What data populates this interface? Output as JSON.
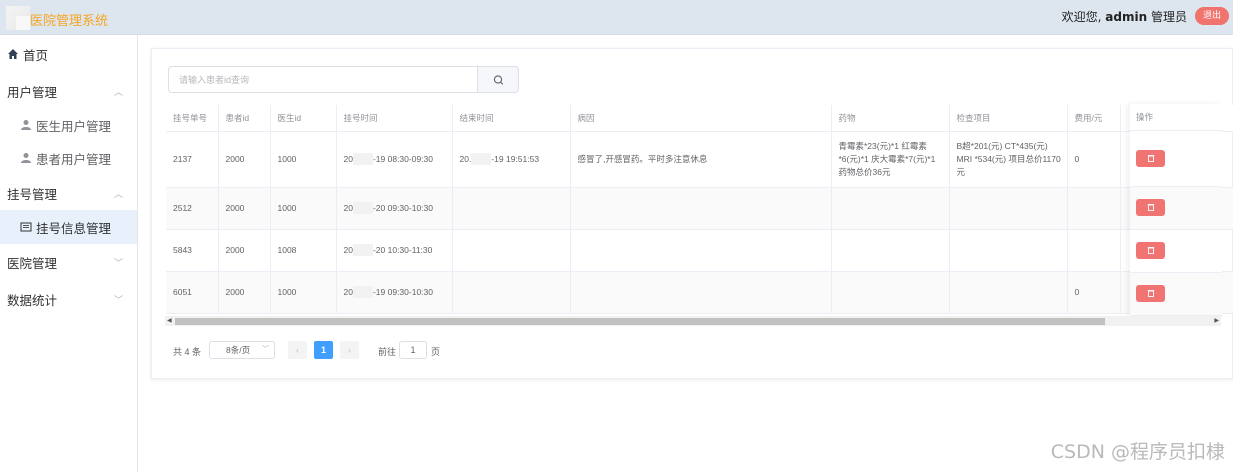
{
  "header": {
    "app_title": "医院管理系统",
    "welcome_prefix": "欢迎您, ",
    "username": "admin",
    "role": "管理员",
    "logout_label": "退出"
  },
  "sidebar": {
    "items": [
      {
        "label": "首页",
        "icon": "home-icon"
      },
      {
        "label": "用户管理",
        "expanded": true
      },
      {
        "label": "医生用户管理",
        "icon": "user-icon"
      },
      {
        "label": "患者用户管理",
        "icon": "user-icon"
      },
      {
        "label": "挂号管理",
        "expanded": true
      },
      {
        "label": "挂号信息管理",
        "icon": "document-icon",
        "active": true
      },
      {
        "label": "医院管理",
        "expanded": false
      },
      {
        "label": "数据统计",
        "expanded": false
      }
    ]
  },
  "search": {
    "placeholder": "请输入患者id查询",
    "icon": "search-icon"
  },
  "table": {
    "columns": [
      "挂号单号",
      "患者id",
      "医生id",
      "挂号时间",
      "结束时间",
      "病因",
      "药物",
      "检查项目",
      "费用/元",
      "操作"
    ],
    "rows": [
      {
        "reg_no": "2137",
        "patient_id": "2000",
        "doctor_id": "1000",
        "reg_time_prefix": "20",
        "reg_time_suffix": "-19 08:30-09:30",
        "end_time_prefix": "20.",
        "end_time_suffix": "-19 19:51:53",
        "cause": "感冒了,开感冒药。平时多注意休息",
        "medicine": "青霉素*23(元)*1 红霉素*6(元)*1 庆大霉素*7(元)*1 药物总价36元",
        "exam": "B超*201(元) CT*435(元) MRI *534(元) 项目总价1170元",
        "fee": "0"
      },
      {
        "reg_no": "2512",
        "patient_id": "2000",
        "doctor_id": "1000",
        "reg_time_prefix": "20",
        "reg_time_suffix": "-20 09:30-10:30",
        "end_time_prefix": "",
        "end_time_suffix": "",
        "cause": "",
        "medicine": "",
        "exam": "",
        "fee": ""
      },
      {
        "reg_no": "5843",
        "patient_id": "2000",
        "doctor_id": "1008",
        "reg_time_prefix": "20",
        "reg_time_suffix": "-20 10:30-11:30",
        "end_time_prefix": "",
        "end_time_suffix": "",
        "cause": "",
        "medicine": "",
        "exam": "",
        "fee": ""
      },
      {
        "reg_no": "6051",
        "patient_id": "2000",
        "doctor_id": "1000",
        "reg_time_prefix": "20",
        "reg_time_suffix": "-19 09:30-10:30",
        "end_time_prefix": "",
        "end_time_suffix": "",
        "cause": "",
        "medicine": "",
        "exam": "",
        "fee": "0"
      }
    ],
    "delete_icon": "trash-icon"
  },
  "pagination": {
    "total_label": "共 4 条",
    "page_size_label": "8条/页",
    "current_page": "1",
    "goto_label": "前往",
    "goto_value": "1",
    "page_unit": "页"
  },
  "watermark": "CSDN @程序员扣棣",
  "colors": {
    "header_bg": "#dde5ee",
    "title_color": "#f5a623",
    "danger": "#f07572",
    "primary": "#409eff"
  }
}
